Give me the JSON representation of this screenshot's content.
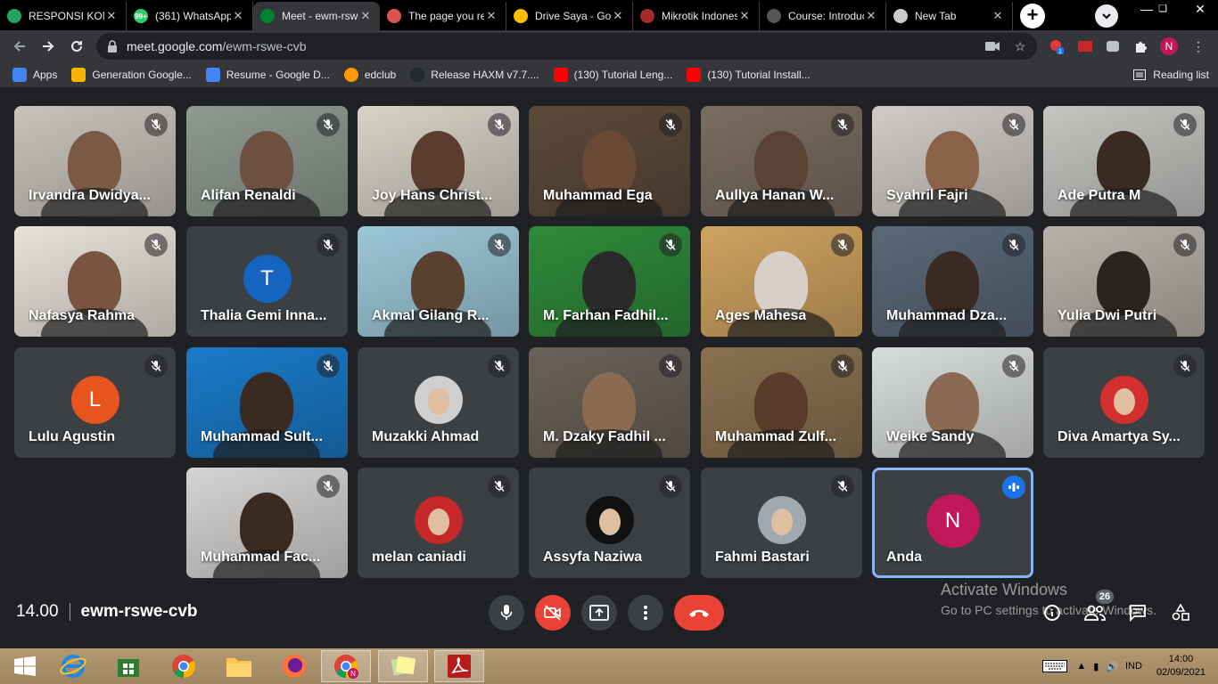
{
  "browser": {
    "tabs": [
      {
        "title": "RESPONSI KONSEP JARINGAN",
        "favicon_color": "#1fa463"
      },
      {
        "title": "(361) WhatsApp",
        "favicon_color": "#25d366",
        "favicon_text": "99+"
      },
      {
        "title": "Meet - ewm-rswe-cvb",
        "favicon_color": "#00832d",
        "active": true
      },
      {
        "title": "The page you requested",
        "favicon_color": "#d9534f"
      },
      {
        "title": "Drive Saya - Google Drive",
        "favicon_color": "#fbbc04"
      },
      {
        "title": "Mikrotik Indonesia",
        "favicon_color": "#a52a2a"
      },
      {
        "title": "Course: Introduction",
        "favicon_color": "#555555"
      },
      {
        "title": "New Tab",
        "favicon_color": "#cccccc"
      }
    ],
    "url_host": "meet.google.com",
    "url_path": "/ewm-rswe-cvb",
    "profile_initial": "N",
    "bookmarks": [
      {
        "label": "Apps",
        "icon": "grid-icon"
      },
      {
        "label": "Generation Google...",
        "icon": "google-icon"
      },
      {
        "label": "Resume - Google D...",
        "icon": "docs-icon"
      },
      {
        "label": "edclub",
        "icon": "edclub-icon"
      },
      {
        "label": "Release HAXM v7.7....",
        "icon": "github-icon"
      },
      {
        "label": "(130) Tutorial Leng...",
        "icon": "youtube-icon"
      },
      {
        "label": "(130) Tutorial Install...",
        "icon": "youtube-icon"
      }
    ],
    "reading_list": "Reading list"
  },
  "participants": [
    {
      "name": "Irvandra Dwidya...",
      "bg": "#c9c3bc",
      "skin": "#7a5a44"
    },
    {
      "name": "Alifan Renaldi",
      "bg": "#8f9a92",
      "skin": "#6d5040"
    },
    {
      "name": "Joy Hans Christ...",
      "bg": "#d8d2c6",
      "skin": "#5a3d2e"
    },
    {
      "name": "Muhammad Ega",
      "bg": "#5c4a3a",
      "skin": "#6a4a36"
    },
    {
      "name": "Aullya Hanan W...",
      "bg": "#7a6d60",
      "skin": "#5a4334"
    },
    {
      "name": "Syahril Fajri",
      "bg": "#d0cbc6",
      "skin": "#8a6248"
    },
    {
      "name": "Ade Putra M",
      "bg": "#c4c6c2",
      "skin": "#3a2a22"
    },
    {
      "name": "Nafasya Rahma",
      "bg": "#e8e2da",
      "skin": "#7a5440"
    },
    {
      "name": "Thalia Gemi Inna...",
      "avatar_letter": "T",
      "avatar_color": "#1565c0"
    },
    {
      "name": "Akmal Gilang R...",
      "bg": "#9cc8d8",
      "skin": "#5a4030"
    },
    {
      "name": "M. Farhan Fadhil...",
      "bg": "#2f8a3a",
      "skin": "#2a2a2a"
    },
    {
      "name": "Ages Mahesa",
      "bg": "#cfa360",
      "skin": "#d8d0c8"
    },
    {
      "name": "Muhammad Dza...",
      "bg": "#5a6878",
      "skin": "#3a2a22"
    },
    {
      "name": "Yulia Dwi Putri",
      "bg": "#b8b2aa",
      "skin": "#2a2420"
    },
    {
      "name": "Lulu Agustin",
      "avatar_letter": "L",
      "avatar_color": "#e8541e"
    },
    {
      "name": "Muhammad Sult...",
      "bg": "#1a7ac8",
      "skin": "#3a2a22"
    },
    {
      "name": "Muzakki Ahmad",
      "avatar_photo": true,
      "avatar_color": "#cfcfcf"
    },
    {
      "name": "M. Dzaky Fadhil ...",
      "bg": "#6a6258",
      "skin": "#8a6a50"
    },
    {
      "name": "Muhammad Zulf...",
      "bg": "#8a7250",
      "skin": "#5a3a28"
    },
    {
      "name": "Weike Sandy",
      "bg": "#d8dcda",
      "skin": "#8a6a52"
    },
    {
      "name": "Diva Amartya Sy...",
      "avatar_photo": true,
      "avatar_color": "#d32f2f"
    },
    {
      "name": "Muhammad Fac...",
      "bg": "#d6d4d2",
      "skin": "#3a2a22"
    },
    {
      "name": "melan caniadi",
      "avatar_photo": true,
      "avatar_color": "#c62828"
    },
    {
      "name": "Assyfa Naziwa",
      "avatar_photo": true,
      "avatar_color": "#111111"
    },
    {
      "name": "Fahmi Bastari",
      "avatar_photo": true,
      "avatar_color": "#a0a8b0"
    },
    {
      "name": "Anda",
      "avatar_letter": "N",
      "avatar_color": "#c2185b",
      "speaking": true
    }
  ],
  "meeting": {
    "time": "14.00",
    "code": "ewm-rswe-cvb",
    "participant_count": "26"
  },
  "windows": {
    "activate_title": "Activate Windows",
    "activate_sub": "Go to PC settings to activate Windows.",
    "lang": "IND",
    "clock_time": "14:00",
    "clock_date": "02/09/2021"
  }
}
